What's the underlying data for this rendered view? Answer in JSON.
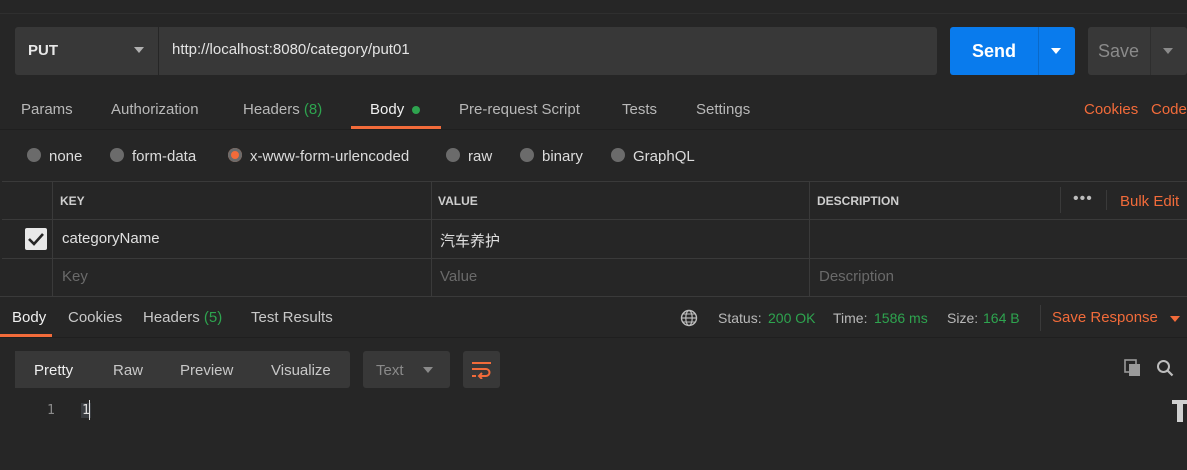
{
  "request": {
    "method": "PUT",
    "url": "http://localhost:8080/category/put01",
    "send_label": "Send",
    "save_label": "Save"
  },
  "request_tabs": {
    "params": "Params",
    "authorization": "Authorization",
    "headers": "Headers",
    "headers_count": "(8)",
    "body": "Body",
    "prerequest": "Pre-request Script",
    "tests": "Tests",
    "settings": "Settings",
    "cookies": "Cookies",
    "code": "Code"
  },
  "body_types": [
    "none",
    "form-data",
    "x-www-form-urlencoded",
    "raw",
    "binary",
    "GraphQL"
  ],
  "body_type_selected": "x-www-form-urlencoded",
  "table": {
    "headers": {
      "key": "KEY",
      "value": "VALUE",
      "description": "DESCRIPTION"
    },
    "bulk_edit": "Bulk Edit",
    "more": "•••",
    "rows": [
      {
        "checked": true,
        "key": "categoryName",
        "value": "汽车养护",
        "description": ""
      }
    ],
    "placeholders": {
      "key": "Key",
      "value": "Value",
      "description": "Description"
    }
  },
  "response_tabs": {
    "body": "Body",
    "cookies": "Cookies",
    "headers": "Headers",
    "headers_count": "(5)",
    "test_results": "Test Results"
  },
  "response_meta": {
    "status_label": "Status:",
    "status_value": "200 OK",
    "time_label": "Time:",
    "time_value": "1586 ms",
    "size_label": "Size:",
    "size_value": "164 B",
    "save_response": "Save Response"
  },
  "view": {
    "pretty": "Pretty",
    "raw": "Raw",
    "preview": "Preview",
    "visualize": "Visualize",
    "format": "Text"
  },
  "response_body": {
    "line_number": "1",
    "content": "1"
  },
  "colors": {
    "accent": "#f26b3a",
    "send": "#097bed",
    "success": "#2ea44f",
    "background": "#262626"
  }
}
